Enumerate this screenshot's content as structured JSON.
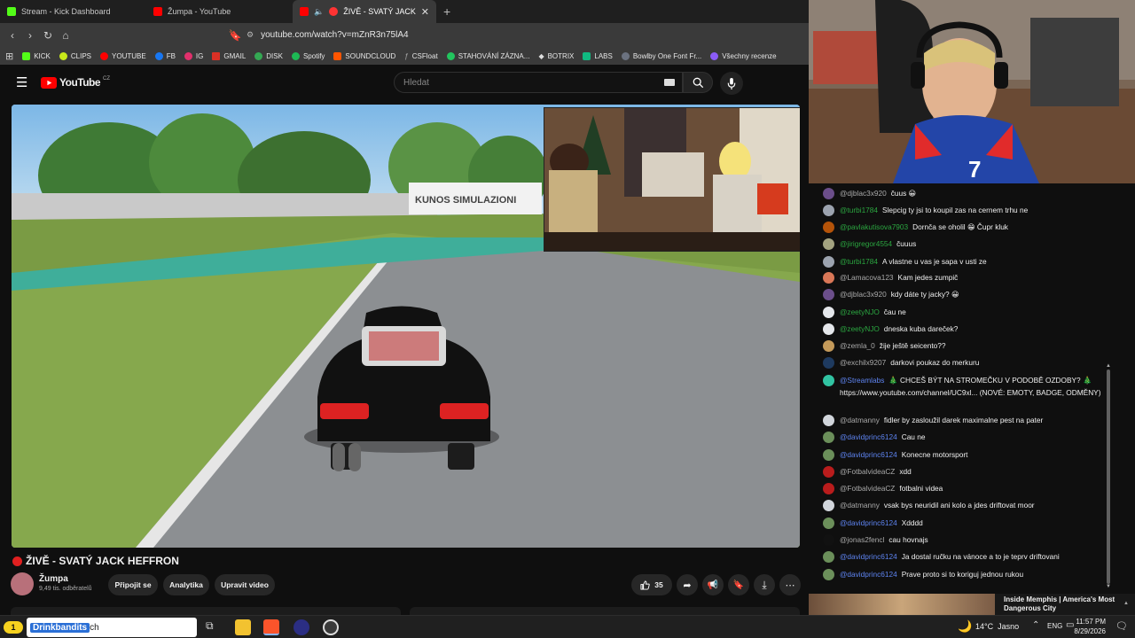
{
  "browser": {
    "tabs": [
      {
        "label": "Stream - Kick Dashboard",
        "active": false,
        "color": "#53fc18"
      },
      {
        "label": "Žumpa - YouTube",
        "active": false,
        "color": "#ff0000"
      },
      {
        "label": "ŽIVĚ - SVATÝ JACK HEFFRC",
        "active": true,
        "color": "#ff0000"
      }
    ],
    "new_tab": "+",
    "url": "youtube.com/watch?v=mZnR3n75lA4",
    "bookmarks": [
      {
        "label": "KICK",
        "color": "#53fc18"
      },
      {
        "label": "CLIPS",
        "color": "#c8e81a"
      },
      {
        "label": "YOUTUBE",
        "color": "#ff0000"
      },
      {
        "label": "FB",
        "color": "#1877f2"
      },
      {
        "label": "IG",
        "color": "#e1306c"
      },
      {
        "label": "GMAIL",
        "color": "#d93025"
      },
      {
        "label": "DISK",
        "color": "#34a853"
      },
      {
        "label": "Spotify",
        "color": "#1db954"
      },
      {
        "label": "SOUNDCLOUD",
        "color": "#ff5500"
      },
      {
        "label": "CSFloat",
        "color": "#888888"
      },
      {
        "label": "STAHOVÁNÍ ZÁZNA...",
        "color": "#22c55e"
      },
      {
        "label": "BOTRIX",
        "color": "#dddddd"
      },
      {
        "label": "LABS",
        "color": "#10b981"
      },
      {
        "label": "Bowlby One Font Fr...",
        "color": "#6b7280"
      },
      {
        "label": "Všechny recenze",
        "color": "#8b5cf6"
      }
    ]
  },
  "youtube": {
    "logo": "YouTube",
    "region": "CZ",
    "search_placeholder": "Hledat",
    "video": {
      "pip_sign": "KUNOS SIMULAZIONI",
      "title": "ŽIVĚ - SVATÝ JACK HEFFRON",
      "channel": "Žumpa",
      "subscribers": "9,49 tis. odběratelů",
      "join_label": "Připojit se",
      "analytics_label": "Analytika",
      "edit_label": "Upravit video",
      "likes": "35"
    }
  },
  "chat": {
    "messages": [
      {
        "user": "@djblac3x920",
        "text": "čuus 😀",
        "color": "#aaaaaa",
        "avatar": "#6b4e8a"
      },
      {
        "user": "@turbi1784",
        "text": "Slepcig ty jsi to koupil zas na cernem trhu ne",
        "color": "#2ba640",
        "avatar": "#9ca3af"
      },
      {
        "user": "@pavlakutisova7903",
        "text": "Dornča se oholil 😁 Čupr kluk",
        "color": "#2ba640",
        "avatar": "#b45309"
      },
      {
        "user": "@jirigregor4554",
        "text": "čuuus",
        "color": "#2ba640",
        "avatar": "#a3a380"
      },
      {
        "user": "@turbi1784",
        "text": "A vlastne u vas je sapa v usti ze",
        "color": "#2ba640",
        "avatar": "#9ca3af"
      },
      {
        "user": "@Lamacova123",
        "text": "Kam jedes zumpič",
        "color": "#aaaaaa",
        "avatar": "#d97757"
      },
      {
        "user": "@djblac3x920",
        "text": "kdy dáte ty jacky? 😀",
        "color": "#aaaaaa",
        "avatar": "#6b4e8a"
      },
      {
        "user": "@zeetyNJO",
        "text": "čau ne",
        "color": "#2ba640",
        "avatar": "#e5e7eb"
      },
      {
        "user": "@zeetyNJO",
        "text": "dneska kuba dareček?",
        "color": "#2ba640",
        "avatar": "#e5e7eb"
      },
      {
        "user": "@zemla_0",
        "text": "žije ještě seicento??",
        "color": "#aaaaaa",
        "avatar": "#c49a5a"
      },
      {
        "user": "@exchilx9207",
        "text": "darkovi poukaz do merkuru",
        "color": "#aaaaaa",
        "avatar": "#1e3a5f"
      },
      {
        "user": "@Streamlabs",
        "text": "🎄 CHCEŠ BÝT NA STROMEČKU V PODOBĚ OZDOBY? 🎄 https://www.youtube.com/channel/UC9xl... (NOVÉ: EMOTY, BADGE, ODMĚNY)",
        "color": "#5e84f1",
        "avatar": "#31c3a2"
      },
      {
        "user": "@datmanny",
        "text": "fidler by zasloužil darek maximalne pest na pater",
        "color": "#aaaaaa",
        "avatar": "#d1d5db"
      },
      {
        "user": "@davidprinc6124",
        "text": "Cau ne",
        "color": "#5e84f1",
        "avatar": "#6b8f5a"
      },
      {
        "user": "@davidprinc6124",
        "text": "Konecne motorsport",
        "color": "#5e84f1",
        "avatar": "#6b8f5a"
      },
      {
        "user": "@FotbalvideaCZ",
        "text": "xdd",
        "color": "#aaaaaa",
        "avatar": "#b91c1c"
      },
      {
        "user": "@FotbalvideaCZ",
        "text": "fotbalni videa",
        "color": "#aaaaaa",
        "avatar": "#b91c1c"
      },
      {
        "user": "@datmanny",
        "text": "vsak bys neuridil ani kolo a jdes driftovat moor",
        "color": "#aaaaaa",
        "avatar": "#d1d5db"
      },
      {
        "user": "@davidprinc6124",
        "text": "Xdddd",
        "color": "#5e84f1",
        "avatar": "#6b8f5a"
      },
      {
        "user": "@jonas2fencl",
        "text": "cau hovnajs",
        "color": "#aaaaaa",
        "avatar": "#111111"
      },
      {
        "user": "@davidprinc6124",
        "text": "Ja dostal ručku na vánoce a to je teprv driftovani",
        "color": "#5e84f1",
        "avatar": "#6b8f5a"
      },
      {
        "user": "@davidprinc6124",
        "text": "Prave proto si to koriguj jednou rukou",
        "color": "#5e84f1",
        "avatar": "#6b8f5a"
      }
    ],
    "next_video_title": "Inside Memphis | America's Most Dangerous City"
  },
  "taskbar": {
    "search_text": "Drinkbandits",
    "search_suffix": "ch",
    "notif_count": "1",
    "weather": "14°C  Jasno",
    "language": "ENG",
    "time": "11:57 PM",
    "date": "8/29/2026"
  }
}
